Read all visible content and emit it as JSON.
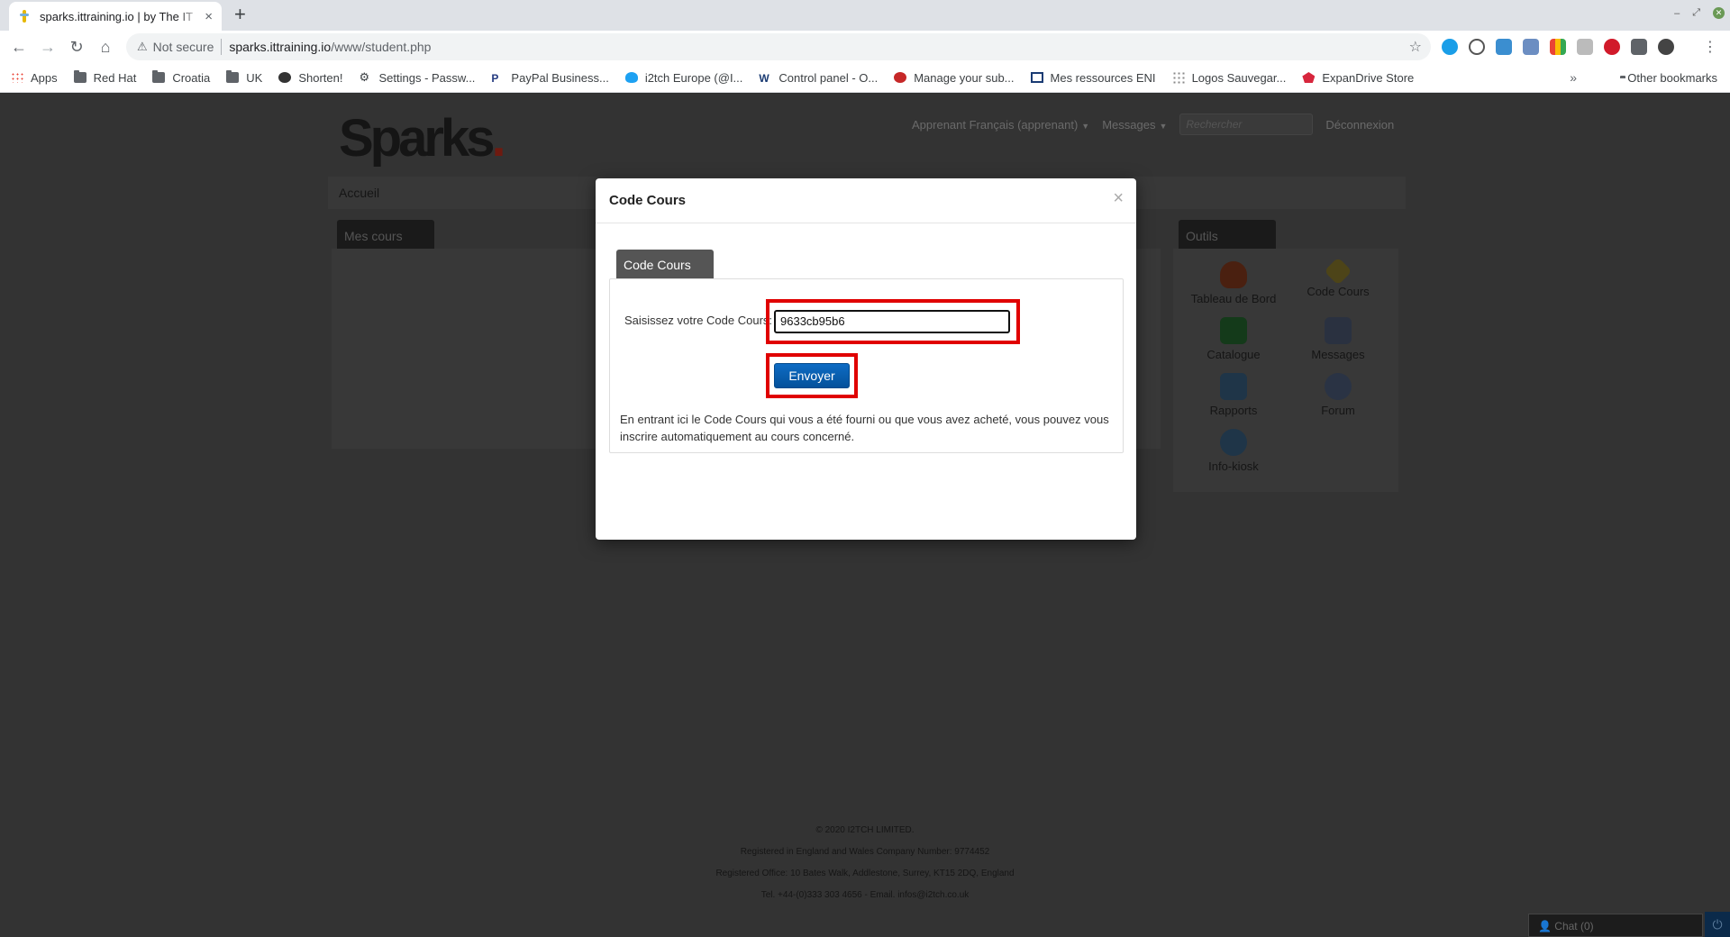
{
  "browser": {
    "tab_title": "sparks.ittraining.io | by The IT",
    "tab_close": "×",
    "new_tab": "+",
    "not_secure": "Not secure",
    "url_host": "sparks.ittraining.io",
    "url_path": "/www/student.php",
    "bookmarks": [
      {
        "label": "Apps",
        "icon": "apps-icon"
      },
      {
        "label": "Red Hat",
        "icon": "folder-icon"
      },
      {
        "label": "Croatia",
        "icon": "folder-icon"
      },
      {
        "label": "UK",
        "icon": "folder-icon"
      },
      {
        "label": "Shorten!",
        "icon": "globe-icon"
      },
      {
        "label": "Settings - Passw...",
        "icon": "gear-icon"
      },
      {
        "label": "PayPal Business...",
        "icon": "paypal-icon"
      },
      {
        "label": "i2tch Europe (@I...",
        "icon": "twitter-icon"
      },
      {
        "label": "Control panel - O...",
        "icon": "ovh-icon"
      },
      {
        "label": "Manage your sub...",
        "icon": "subscription-icon"
      },
      {
        "label": "Mes ressources ENI",
        "icon": "eni-icon"
      },
      {
        "label": "Logos Sauvegar...",
        "icon": "grid-icon"
      },
      {
        "label": "ExpanDrive Store",
        "icon": "expandrive-icon"
      }
    ],
    "bookmarks_overflow": "»",
    "other_bookmarks": "Other bookmarks"
  },
  "page": {
    "logo": "Sparks",
    "logo_dot": ".",
    "user_menu": "Apprenant Français (apprenant)",
    "messages_menu": "Messages",
    "search_placeholder": "Rechercher",
    "logout": "Déconnexion",
    "breadcrumb": "Accueil",
    "my_courses_tab": "Mes cours",
    "tools_tab": "Outils",
    "tools": [
      "Tableau de Bord",
      "Code Cours",
      "Catalogue",
      "Messages",
      "Rapports",
      "Forum",
      "Info-kiosk"
    ],
    "footer": [
      "© 2020 I2TCH LIMITED.",
      "Registered in England and Wales Company Number: 9774452",
      "Registered Office: 10 Bates Walk, Addlestone, Surrey, KT15 2DQ, England",
      "Tel. +44-(0)333 303 4656 - Email. infos@i2tch.co.uk"
    ],
    "chat": "Chat (0)"
  },
  "modal": {
    "title": "Code Cours",
    "close": "×",
    "tab_label": "Code Cours",
    "field_label": "Saisissez votre Code Cours:",
    "field_value": "9633cb95b6",
    "submit_label": "Envoyer",
    "help_text": "En entrant ici le Code Cours qui vous a été fourni ou que vous avez acheté, vous pouvez vous inscrire automatiquement au cours concerné."
  },
  "colors": {
    "highlight": "#e00000",
    "button_blue": "#04519b",
    "overlay": "#333333"
  }
}
